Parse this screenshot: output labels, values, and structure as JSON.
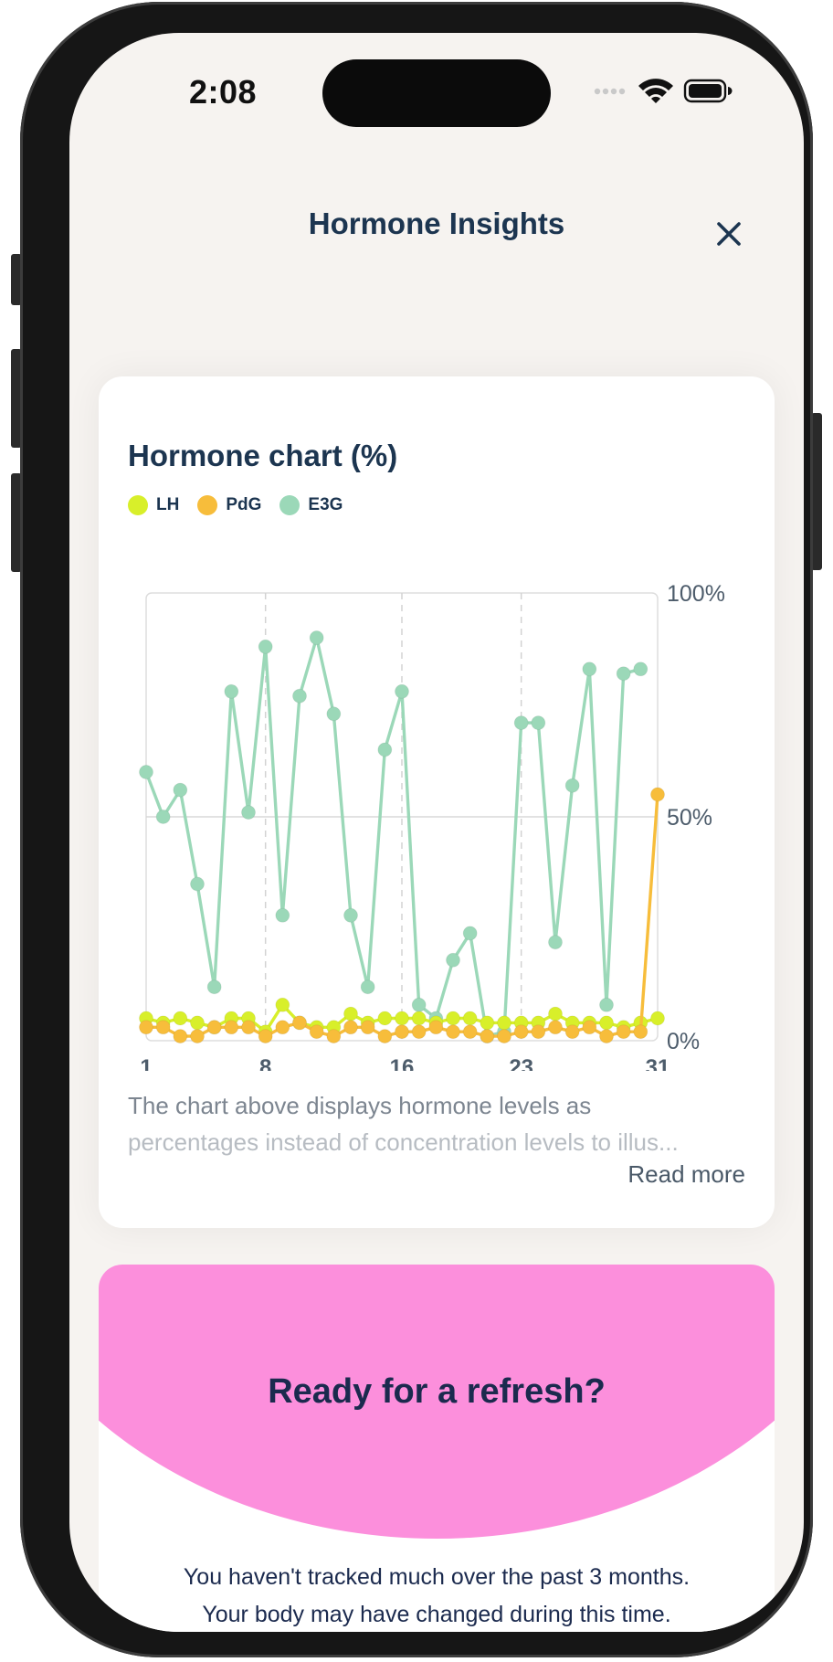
{
  "status_bar": {
    "time": "2:08",
    "icons": [
      "signal-dots-icon",
      "wifi-icon",
      "battery-icon"
    ]
  },
  "header": {
    "title": "Hormone Insights",
    "close_icon": "close-icon"
  },
  "chart_card": {
    "title": "Hormone chart (%)",
    "caption_line1": "The chart above displays hormone levels as",
    "caption_line2": "percentages instead of concentration levels to illus...",
    "read_more": "Read more"
  },
  "colors": {
    "LH": "#d8ef2a",
    "PdG": "#f7bd3b",
    "E3G": "#9bd8b8",
    "navy": "#1c3550",
    "pink": "#fc8fdc"
  },
  "chart_data": {
    "type": "line",
    "title": "Hormone chart (%)",
    "x_ticks": [
      "1",
      "8",
      "16",
      "23",
      "31"
    ],
    "y_ticks": [
      "0%",
      "50%",
      "100%"
    ],
    "xlim": [
      1,
      31
    ],
    "ylim": [
      0,
      100
    ],
    "grid": true,
    "legend_position": "top-left",
    "y_axis_side": "right",
    "series": [
      {
        "name": "E3G",
        "color": "#9bd8b8",
        "values": [
          60,
          50,
          56,
          35,
          12,
          78,
          51,
          88,
          28,
          77,
          90,
          73,
          28,
          12,
          65,
          78,
          8,
          5,
          18,
          24,
          1,
          2,
          71,
          71,
          22,
          57,
          83,
          8,
          82,
          83
        ]
      },
      {
        "name": "LH",
        "color": "#d8ef2a",
        "values": [
          5,
          4,
          5,
          4,
          3,
          5,
          5,
          2,
          8,
          4,
          3,
          3,
          6,
          4,
          5,
          5,
          5,
          4,
          5,
          5,
          4,
          4,
          4,
          4,
          6,
          4,
          4,
          4,
          3,
          4,
          5
        ]
      },
      {
        "name": "PdG",
        "color": "#f7bd3b",
        "values": [
          3,
          3,
          1,
          1,
          3,
          3,
          3,
          1,
          3,
          4,
          2,
          1,
          3,
          3,
          1,
          2,
          2,
          3,
          2,
          2,
          1,
          1,
          2,
          2,
          3,
          2,
          3,
          1,
          2,
          2,
          55
        ]
      }
    ]
  },
  "refresh_card": {
    "title": "Ready for a refresh?",
    "body_line1": "You haven't tracked much over the past 3 months.",
    "body_line2": "Your body may have changed during this time."
  }
}
